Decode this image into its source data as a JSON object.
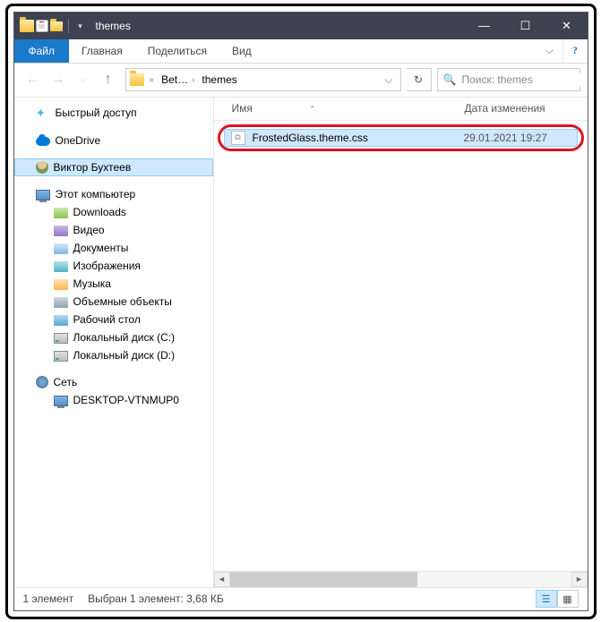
{
  "window": {
    "title": "themes"
  },
  "tabs": {
    "file": "Файл",
    "home": "Главная",
    "share": "Поделиться",
    "view": "Вид"
  },
  "breadcrumb": {
    "part1": "Bet…",
    "part2": "themes"
  },
  "search": {
    "placeholder": "Поиск: themes"
  },
  "sidebar": {
    "quick": "Быстрый доступ",
    "onedrive": "OneDrive",
    "user": "Виктор Бухтеев",
    "pc": "Этот компьютер",
    "downloads": "Downloads",
    "video": "Видео",
    "docs": "Документы",
    "images": "Изображения",
    "music": "Музыка",
    "objects3d": "Объемные объекты",
    "desktop": "Рабочий стол",
    "driveC": "Локальный диск (C:)",
    "driveD": "Локальный диск (D:)",
    "network": "Сеть",
    "netpc": "DESKTOP-VTNMUP0"
  },
  "columns": {
    "name": "Имя",
    "date": "Дата изменения"
  },
  "file": {
    "name": "FrostedGlass.theme.css",
    "date": "29.01.2021 19:27"
  },
  "status": {
    "count": "1 элемент",
    "selected": "Выбран 1 элемент: 3,68 КБ"
  }
}
